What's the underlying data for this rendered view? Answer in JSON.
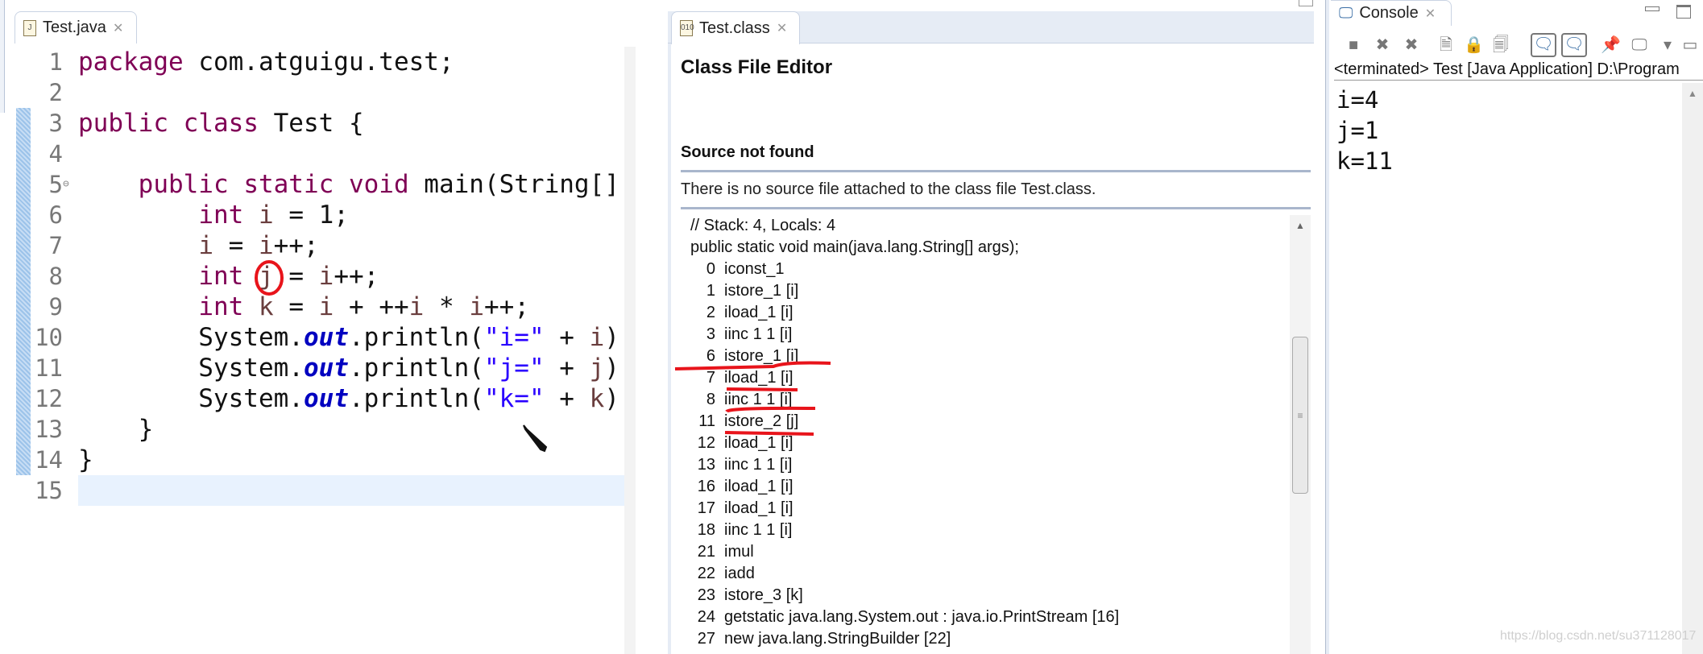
{
  "editor": {
    "tab_label": "Test.java",
    "lines": [
      {
        "num": "1",
        "tokens": [
          {
            "t": "package",
            "c": "kw"
          },
          {
            "t": " com.atguigu.test;",
            "c": ""
          }
        ]
      },
      {
        "num": "2",
        "tokens": []
      },
      {
        "num": "3",
        "tokens": [
          {
            "t": "public",
            "c": "kw"
          },
          {
            "t": " ",
            "c": ""
          },
          {
            "t": "class",
            "c": "kw"
          },
          {
            "t": " Test {",
            "c": ""
          }
        ]
      },
      {
        "num": "4",
        "tokens": []
      },
      {
        "num": "5",
        "tokens": [
          {
            "t": "    ",
            "c": ""
          },
          {
            "t": "public",
            "c": "kw"
          },
          {
            "t": " ",
            "c": ""
          },
          {
            "t": "static",
            "c": "kw"
          },
          {
            "t": " ",
            "c": ""
          },
          {
            "t": "void",
            "c": "kw"
          },
          {
            "t": " main(String[] args) {",
            "c": ""
          }
        ]
      },
      {
        "num": "6",
        "tokens": [
          {
            "t": "        ",
            "c": ""
          },
          {
            "t": "int",
            "c": "kw"
          },
          {
            "t": " ",
            "c": ""
          },
          {
            "t": "i",
            "c": "var"
          },
          {
            "t": " = 1;",
            "c": ""
          }
        ]
      },
      {
        "num": "7",
        "tokens": [
          {
            "t": "        ",
            "c": ""
          },
          {
            "t": "i",
            "c": "var"
          },
          {
            "t": " = ",
            "c": ""
          },
          {
            "t": "i",
            "c": "var"
          },
          {
            "t": "++;",
            "c": ""
          }
        ]
      },
      {
        "num": "8",
        "tokens": [
          {
            "t": "        ",
            "c": ""
          },
          {
            "t": "int",
            "c": "kw"
          },
          {
            "t": " ",
            "c": ""
          },
          {
            "t": "j",
            "c": "var"
          },
          {
            "t": " = ",
            "c": ""
          },
          {
            "t": "i",
            "c": "var"
          },
          {
            "t": "++;",
            "c": ""
          }
        ]
      },
      {
        "num": "9",
        "tokens": [
          {
            "t": "        ",
            "c": ""
          },
          {
            "t": "int",
            "c": "kw"
          },
          {
            "t": " ",
            "c": ""
          },
          {
            "t": "k",
            "c": "var"
          },
          {
            "t": " = ",
            "c": ""
          },
          {
            "t": "i",
            "c": "var"
          },
          {
            "t": " + ++",
            "c": ""
          },
          {
            "t": "i",
            "c": "var"
          },
          {
            "t": " * ",
            "c": ""
          },
          {
            "t": "i",
            "c": "var"
          },
          {
            "t": "++;",
            "c": ""
          }
        ]
      },
      {
        "num": "10",
        "tokens": [
          {
            "t": "        System.",
            "c": ""
          },
          {
            "t": "out",
            "c": "fld"
          },
          {
            "t": ".println(",
            "c": ""
          },
          {
            "t": "\"i=\"",
            "c": "str"
          },
          {
            "t": " + ",
            "c": ""
          },
          {
            "t": "i",
            "c": "var"
          },
          {
            "t": ");",
            "c": ""
          }
        ]
      },
      {
        "num": "11",
        "tokens": [
          {
            "t": "        System.",
            "c": ""
          },
          {
            "t": "out",
            "c": "fld"
          },
          {
            "t": ".println(",
            "c": ""
          },
          {
            "t": "\"j=\"",
            "c": "str"
          },
          {
            "t": " + ",
            "c": ""
          },
          {
            "t": "j",
            "c": "var"
          },
          {
            "t": ");",
            "c": ""
          }
        ]
      },
      {
        "num": "12",
        "tokens": [
          {
            "t": "        System.",
            "c": ""
          },
          {
            "t": "out",
            "c": "fld"
          },
          {
            "t": ".println(",
            "c": ""
          },
          {
            "t": "\"k=\"",
            "c": "str"
          },
          {
            "t": " + ",
            "c": ""
          },
          {
            "t": "k",
            "c": "var"
          },
          {
            "t": ");",
            "c": ""
          }
        ]
      },
      {
        "num": "13",
        "tokens": [
          {
            "t": "    }",
            "c": ""
          }
        ]
      },
      {
        "num": "14",
        "tokens": [
          {
            "t": "}",
            "c": ""
          }
        ]
      },
      {
        "num": "15",
        "tokens": []
      }
    ],
    "current_line": "15"
  },
  "class_editor": {
    "tab_label": "Test.class",
    "title": "Class File Editor",
    "section_title": "Source not found",
    "message": "There is no source file attached to the class file Test.class.",
    "header_lines": [
      "// Stack: 4, Locals: 4",
      "public static void main(java.lang.String[] args);"
    ],
    "bytecode": [
      {
        "n": "0",
        "op": "iconst_1"
      },
      {
        "n": "1",
        "op": "istore_1 [i]"
      },
      {
        "n": "2",
        "op": "iload_1 [i]"
      },
      {
        "n": "3",
        "op": "iinc 1 1 [i]"
      },
      {
        "n": "6",
        "op": "istore_1 [i]"
      },
      {
        "n": "7",
        "op": "iload_1 [i]"
      },
      {
        "n": "8",
        "op": "iinc 1 1 [i]"
      },
      {
        "n": "11",
        "op": "istore_2 [j]"
      },
      {
        "n": "12",
        "op": "iload_1 [i]"
      },
      {
        "n": "13",
        "op": "iinc 1 1 [i]"
      },
      {
        "n": "16",
        "op": "iload_1 [i]"
      },
      {
        "n": "17",
        "op": "iload_1 [i]"
      },
      {
        "n": "18",
        "op": "iinc 1 1 [i]"
      },
      {
        "n": "21",
        "op": "imul"
      },
      {
        "n": "22",
        "op": "iadd"
      },
      {
        "n": "23",
        "op": "istore_3 [k]"
      },
      {
        "n": "24",
        "op": "getstatic java.lang.System.out : java.io.PrintStream [16]"
      },
      {
        "n": "27",
        "op": "new java.lang.StringBuilder [22]"
      }
    ]
  },
  "console": {
    "tab_label": "Console",
    "status": "<terminated> Test [Java Application] D:\\Program",
    "output": [
      "i=4",
      "j=1",
      "k=11"
    ],
    "toolbar_icons": [
      "terminate-icon",
      "remove-launch-icon",
      "remove-all-terminated-icon",
      "clear-console-icon",
      "scroll-lock-icon",
      "word-wrap-icon",
      "show-on-stdout-icon",
      "show-on-stderr-icon",
      "pin-console-icon",
      "display-console-icon",
      "dropdown-icon",
      "open-console-icon"
    ]
  },
  "annotation_color": "#e8141b",
  "watermark": "https://blog.csdn.net/su371128017"
}
